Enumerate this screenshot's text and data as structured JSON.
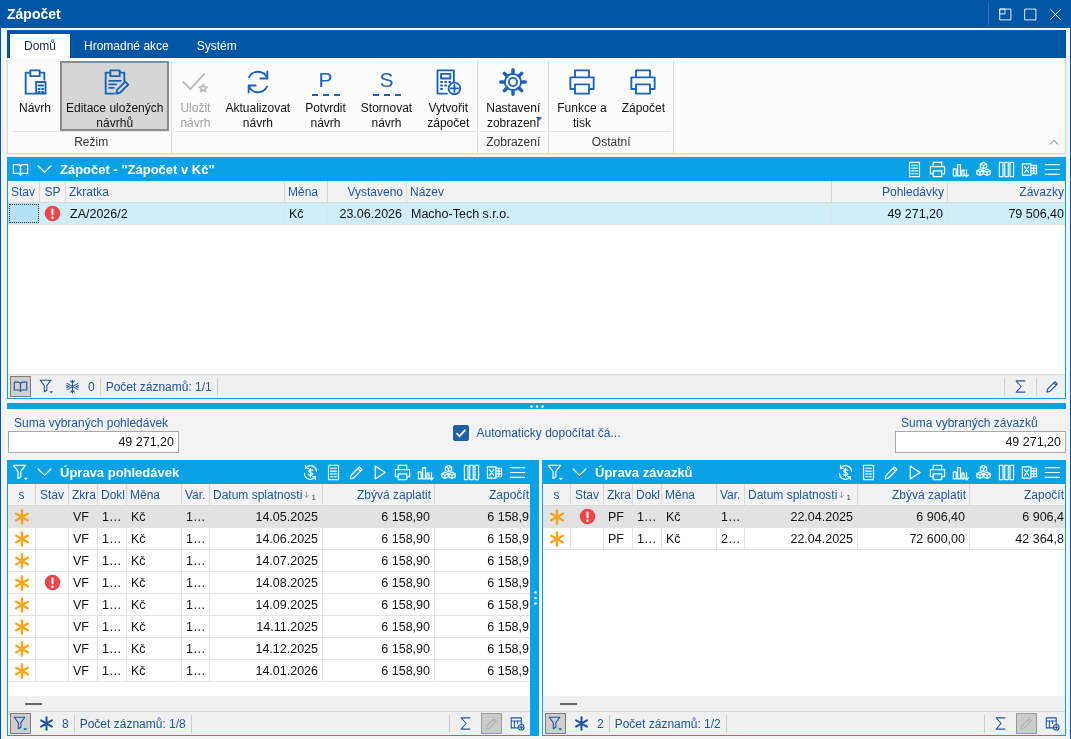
{
  "window": {
    "title": "Zápočet"
  },
  "ribbon": {
    "tabs": [
      {
        "label": "Domů",
        "selected": true
      },
      {
        "label": "Hromadné akce",
        "selected": false
      },
      {
        "label": "Systém",
        "selected": false
      }
    ],
    "groups": [
      {
        "label": "Režim",
        "buttons": [
          {
            "kind": "clipboard",
            "label": "Návrh",
            "selected": false,
            "disabled": false,
            "dropdown": false
          },
          {
            "kind": "clipboard-edit",
            "label": "Editace uložených\nnávrhů",
            "selected": true,
            "disabled": false,
            "dropdown": false
          }
        ]
      },
      {
        "buttons": [
          {
            "kind": "check",
            "label": "Uložit\nnávrh",
            "selected": false,
            "disabled": true,
            "dropdown": false
          },
          {
            "kind": "refresh",
            "label": "Aktualizovat\nnávrh",
            "selected": false,
            "disabled": false,
            "dropdown": false
          },
          {
            "kind": "letter",
            "glyph": "P",
            "label": "Potvrdit\nnávrh",
            "selected": false,
            "disabled": false,
            "dropdown": false
          },
          {
            "kind": "letter",
            "glyph": "S",
            "label": "Stornovat\nnávrh",
            "selected": false,
            "disabled": false,
            "dropdown": false
          },
          {
            "kind": "calculator-add",
            "label": "Vytvořit\nzápočet",
            "selected": false,
            "disabled": false,
            "dropdown": false
          }
        ]
      },
      {
        "label": "Zobrazení",
        "buttons": [
          {
            "kind": "gear",
            "label": "Nastavení\nzobrazení",
            "selected": false,
            "disabled": false,
            "dropdown": true
          }
        ]
      },
      {
        "label": "Ostatní",
        "buttons": [
          {
            "kind": "printer",
            "label": "Funkce a\ntisk",
            "selected": false,
            "disabled": false,
            "dropdown": false
          },
          {
            "kind": "printer",
            "label": "Zápočet",
            "selected": false,
            "disabled": false,
            "dropdown": false
          }
        ]
      }
    ]
  },
  "top_panel": {
    "title": "Zápočet - \"Zápočet v Kč\"",
    "columns": [
      {
        "label": "Stav",
        "kind": "focus"
      },
      {
        "label": "SP",
        "kind": "warning"
      },
      {
        "label": "Zkratka",
        "kind": "text"
      },
      {
        "label": "Měna",
        "kind": "text"
      },
      {
        "label": "Vystaveno",
        "kind": "date"
      },
      {
        "label": "Název",
        "kind": "text"
      },
      {
        "label": "Pohledávky",
        "kind": "number"
      },
      {
        "label": "Závazky",
        "kind": "number"
      }
    ],
    "rows": [
      {
        "selected": true,
        "warning": true,
        "cells": [
          "",
          "",
          "ZA/2026/2",
          "Kč",
          "23.06.2026",
          "Macho-Tech s.r.o.",
          "49 271,20",
          "79 506,40"
        ]
      }
    ],
    "footer": {
      "book_pressed": true,
      "filter_pressed": false,
      "count": "0",
      "records": "Počet záznamů: 1/1",
      "edit_disabled": false
    }
  },
  "sums": {
    "receivables": {
      "label": "Suma vybraných pohledávek",
      "value": "49 271,20"
    },
    "auto_calc": {
      "label": "Automaticky dopočítat čá...",
      "checked": true
    },
    "payables": {
      "label": "Suma vybraných závazků",
      "value": "49 271,20"
    }
  },
  "panels": [
    {
      "title": "Úprava pohledávek",
      "columns": [
        {
          "label": "s",
          "kind": "new"
        },
        {
          "label": "Stav",
          "kind": "warning"
        },
        {
          "label": "Zkra",
          "kind": "text"
        },
        {
          "label": "Dokl",
          "kind": "text"
        },
        {
          "label": "Měna",
          "kind": "text"
        },
        {
          "label": "Var.",
          "kind": "text"
        },
        {
          "label": "Datum splatnosti",
          "kind": "date",
          "sort_order": "1"
        },
        {
          "label": "Zbývá zaplatit",
          "kind": "number"
        },
        {
          "label": "Započít",
          "kind": "number"
        }
      ],
      "rows": [
        {
          "selected": true,
          "new": true,
          "warning": false,
          "cells": [
            "",
            "",
            "VF",
            "1…",
            "Kč",
            "1…",
            "14.05.2025",
            "6 158,90",
            "6 158,9"
          ]
        },
        {
          "selected": false,
          "new": true,
          "warning": false,
          "cells": [
            "",
            "",
            "VF",
            "1…",
            "Kč",
            "1…",
            "14.06.2025",
            "6 158,90",
            "6 158,9"
          ]
        },
        {
          "selected": false,
          "new": true,
          "warning": false,
          "cells": [
            "",
            "",
            "VF",
            "1…",
            "Kč",
            "1…",
            "14.07.2025",
            "6 158,90",
            "6 158,9"
          ]
        },
        {
          "selected": false,
          "new": true,
          "warning": true,
          "cells": [
            "",
            "",
            "VF",
            "1…",
            "Kč",
            "1…",
            "14.08.2025",
            "6 158,90",
            "6 158,9"
          ]
        },
        {
          "selected": false,
          "new": true,
          "warning": false,
          "cells": [
            "",
            "",
            "VF",
            "1…",
            "Kč",
            "1…",
            "14.09.2025",
            "6 158,90",
            "6 158,9"
          ]
        },
        {
          "selected": false,
          "new": true,
          "warning": false,
          "cells": [
            "",
            "",
            "VF",
            "1…",
            "Kč",
            "1…",
            "14.11.2025",
            "6 158,90",
            "6 158,9"
          ]
        },
        {
          "selected": false,
          "new": true,
          "warning": false,
          "cells": [
            "",
            "",
            "VF",
            "1…",
            "Kč",
            "1…",
            "14.12.2025",
            "6 158,90",
            "6 158,9"
          ]
        },
        {
          "selected": false,
          "new": true,
          "warning": false,
          "cells": [
            "",
            "",
            "VF",
            "1…",
            "Kč",
            "1…",
            "14.01.2026",
            "6 158,90",
            "6 158,9"
          ]
        }
      ],
      "footer": {
        "filter_pressed": true,
        "count": "8",
        "records": "Počet záznamů: 1/8",
        "edit_disabled": true
      }
    },
    {
      "title": "Úprava závazků",
      "columns": [
        {
          "label": "s",
          "kind": "new"
        },
        {
          "label": "Stav",
          "kind": "warning"
        },
        {
          "label": "Zkra",
          "kind": "text"
        },
        {
          "label": "Dokl",
          "kind": "text"
        },
        {
          "label": "Měna",
          "kind": "text"
        },
        {
          "label": "Var.",
          "kind": "text"
        },
        {
          "label": "Datum splatnosti",
          "kind": "date",
          "sort_order": "1"
        },
        {
          "label": "Zbývá zaplatit",
          "kind": "number"
        },
        {
          "label": "Započít",
          "kind": "number"
        }
      ],
      "rows": [
        {
          "selected": true,
          "new": true,
          "warning": true,
          "cells": [
            "",
            "",
            "PF",
            "1…",
            "Kč",
            "1…",
            "22.04.2025",
            "6 906,40",
            "6 906,4"
          ]
        },
        {
          "selected": false,
          "new": true,
          "warning": false,
          "cells": [
            "",
            "",
            "PF",
            "1…",
            "Kč",
            "2…",
            "22.04.2025",
            "72 600,00",
            "42 364,8"
          ]
        }
      ],
      "footer": {
        "filter_pressed": true,
        "count": "2",
        "records": "Počet záznamů: 1/2",
        "edit_disabled": true
      }
    }
  ]
}
